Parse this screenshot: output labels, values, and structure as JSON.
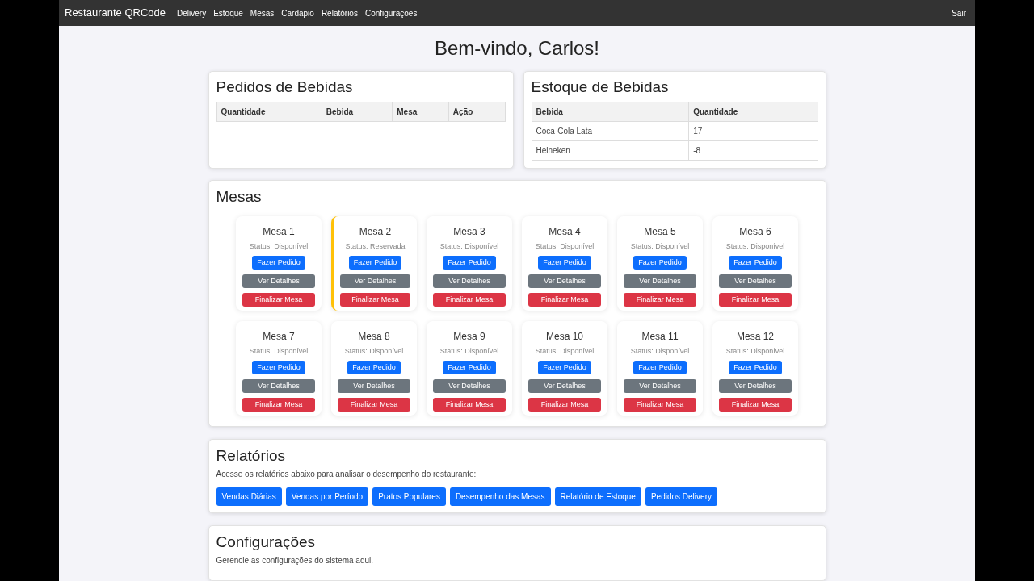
{
  "navbar": {
    "brand": "Restaurante QRCode",
    "links": [
      "Delivery",
      "Estoque",
      "Mesas",
      "Cardápio",
      "Relatórios",
      "Configurações"
    ],
    "logout": "Sair"
  },
  "welcome": "Bem-vindo, Carlos!",
  "drink_orders": {
    "title": "Pedidos de Bebidas",
    "columns": [
      "Quantidade",
      "Bebida",
      "Mesa",
      "Ação"
    ]
  },
  "drink_stock": {
    "title": "Estoque de Bebidas",
    "columns": [
      "Bebida",
      "Quantidade"
    ],
    "rows": [
      [
        "Coca-Cola Lata",
        "17"
      ],
      [
        "Heineken",
        "-8"
      ]
    ]
  },
  "tables_section": {
    "title": "Mesas",
    "tables": [
      {
        "name": "Mesa 1",
        "status": "Status: Disponível",
        "reserved": false,
        "buttons": [
          {
            "label": "Fazer Pedido",
            "kind": "primary"
          },
          {
            "label": "Ver Detalhes",
            "kind": "secondary"
          },
          {
            "label": "Finalizar Mesa",
            "kind": "danger"
          }
        ]
      },
      {
        "name": "Mesa 2",
        "status": "Status: Reservada",
        "reserved": true,
        "buttons": [
          {
            "label": "Fazer Pedido",
            "kind": "primary"
          },
          {
            "label": "Ver Detalhes",
            "kind": "secondary"
          },
          {
            "label": "Finalizar Mesa",
            "kind": "danger"
          }
        ]
      },
      {
        "name": "Mesa 3",
        "status": "Status: Disponível",
        "reserved": false,
        "buttons": [
          {
            "label": "Fazer Pedido",
            "kind": "primary"
          },
          {
            "label": "Ver Detalhes",
            "kind": "secondary"
          },
          {
            "label": "Finalizar Mesa",
            "kind": "danger"
          }
        ]
      },
      {
        "name": "Mesa 4",
        "status": "Status: Disponível",
        "reserved": false,
        "buttons": [
          {
            "label": "Fazer Pedido",
            "kind": "primary"
          },
          {
            "label": "Ver Detalhes",
            "kind": "secondary"
          },
          {
            "label": "Finalizar Mesa",
            "kind": "danger"
          }
        ]
      },
      {
        "name": "Mesa 5",
        "status": "Status: Disponível",
        "reserved": false,
        "buttons": [
          {
            "label": "Fazer Pedido",
            "kind": "primary"
          },
          {
            "label": "Ver Detalhes",
            "kind": "secondary"
          },
          {
            "label": "Finalizar Mesa",
            "kind": "danger"
          }
        ]
      },
      {
        "name": "Mesa 6",
        "status": "Status: Disponível",
        "reserved": false,
        "buttons": [
          {
            "label": "Fazer Pedido",
            "kind": "primary"
          },
          {
            "label": "Ver Detalhes",
            "kind": "secondary"
          },
          {
            "label": "Finalizar Mesa",
            "kind": "danger"
          }
        ]
      },
      {
        "name": "Mesa 7",
        "status": "Status: Disponível",
        "reserved": false,
        "buttons": [
          {
            "label": "Fazer Pedido",
            "kind": "primary"
          },
          {
            "label": "Ver Detalhes",
            "kind": "secondary"
          },
          {
            "label": "Finalizar Mesa",
            "kind": "danger"
          }
        ]
      },
      {
        "name": "Mesa 8",
        "status": "Status: Disponível",
        "reserved": false,
        "buttons": [
          {
            "label": "Fazer Pedido",
            "kind": "primary"
          },
          {
            "label": "Ver Detalhes",
            "kind": "secondary"
          },
          {
            "label": "Finalizar Mesa",
            "kind": "danger"
          }
        ]
      },
      {
        "name": "Mesa 9",
        "status": "Status: Disponível",
        "reserved": false,
        "buttons": [
          {
            "label": "Fazer Pedido",
            "kind": "primary"
          },
          {
            "label": "Ver Detalhes",
            "kind": "secondary"
          },
          {
            "label": "Finalizar Mesa",
            "kind": "danger"
          }
        ]
      },
      {
        "name": "Mesa 10",
        "status": "Status: Disponível",
        "reserved": false,
        "buttons": [
          {
            "label": "Fazer Pedido",
            "kind": "primary"
          },
          {
            "label": "Ver Detalhes",
            "kind": "secondary"
          },
          {
            "label": "Finalizar Mesa",
            "kind": "danger"
          }
        ]
      },
      {
        "name": "Mesa 11",
        "status": "Status: Disponível",
        "reserved": false,
        "buttons": [
          {
            "label": "Fazer Pedido",
            "kind": "primary"
          },
          {
            "label": "Ver Detalhes",
            "kind": "secondary"
          },
          {
            "label": "Finalizar Mesa",
            "kind": "danger"
          }
        ]
      },
      {
        "name": "Mesa 12",
        "status": "Status: Disponível",
        "reserved": false,
        "buttons": [
          {
            "label": "Fazer Pedido",
            "kind": "primary"
          },
          {
            "label": "Ver Detalhes",
            "kind": "secondary"
          },
          {
            "label": "Finalizar Mesa",
            "kind": "danger"
          }
        ]
      }
    ]
  },
  "reports": {
    "title": "Relatórios",
    "description": "Acesse os relatórios abaixo para analisar o desempenho do restaurante:",
    "buttons": [
      "Vendas Diárias",
      "Vendas por Período",
      "Pratos Populares",
      "Desempenho das Mesas",
      "Relatório de Estoque",
      "Pedidos Delivery"
    ]
  },
  "settings": {
    "title": "Configurações",
    "description": "Gerencie as configurações do sistema aqui."
  }
}
